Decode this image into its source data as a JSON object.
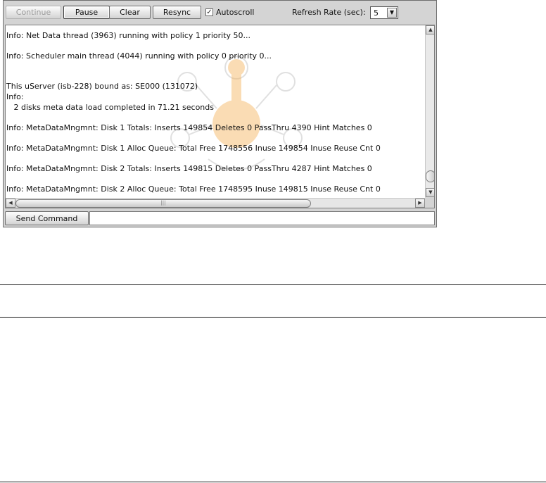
{
  "toolbar": {
    "continue_label": "Continue",
    "pause_label": "Pause",
    "clear_label": "Clear",
    "resync_label": "Resync",
    "autoscroll_label": "Autoscroll",
    "autoscroll_checked": true,
    "refresh_rate_label": "Refresh Rate (sec):",
    "refresh_rate_value": "5"
  },
  "log": {
    "lines": [
      "Info: Net Data thread (3963) running with policy 1 priority 50...",
      "Info: Scheduler main thread (4044) running with policy 0 priority 0...",
      "This uServer (isb-228) bound as: SE000 (131072)",
      "Info:",
      "   2 disks meta data load completed in 71.21 seconds",
      "Info: MetaDataMngmnt: Disk 1 Totals: Inserts 149854 Deletes 0 PassThru 4390 Hint Matches 0",
      "Info: MetaDataMngmnt: Disk 1 Alloc Queue: Total Free 1748556 Inuse 149854 Inuse Reuse Cnt 0",
      "Info: MetaDataMngmnt: Disk 2 Totals: Inserts 149815 Deletes 0 PassThru 4287 Hint Matches 0",
      "Info: MetaDataMngmnt: Disk 2 Alloc Queue: Total Free 1748595 Inuse 149815 Inuse Reuse Cnt 0"
    ]
  },
  "command": {
    "send_label": "Send Command",
    "input_value": ""
  },
  "colors": {
    "panel_bg": "#d4d4d4",
    "watermark": "#f4b25a"
  }
}
